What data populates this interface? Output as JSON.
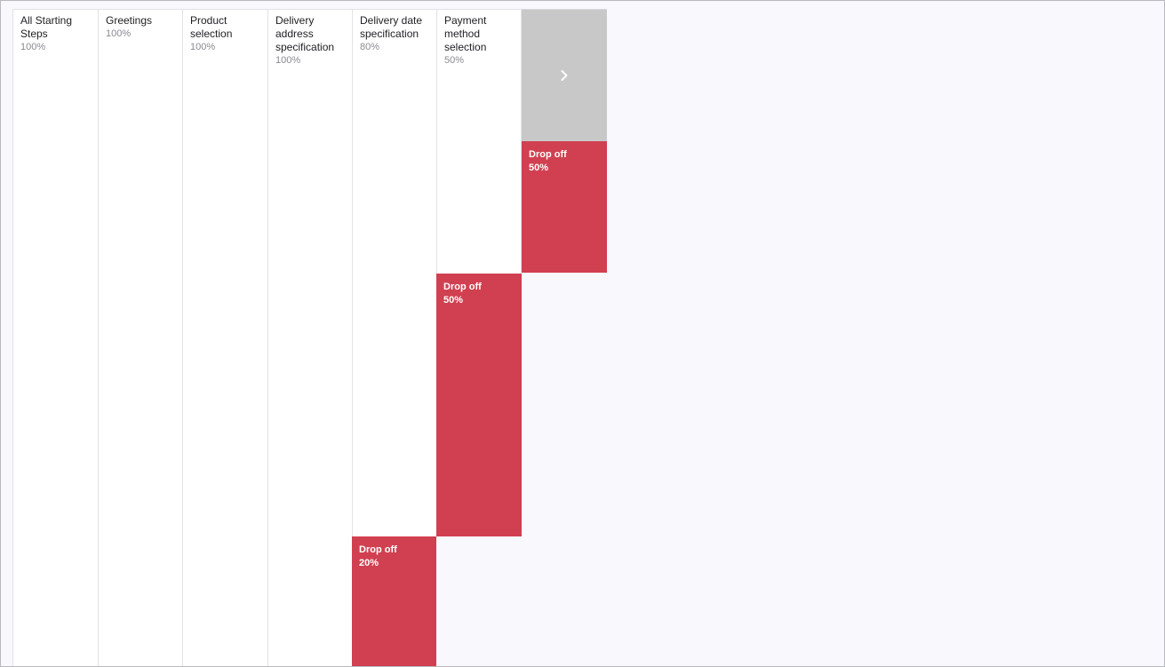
{
  "funnel": {
    "steps": [
      {
        "name": "All Starting Steps",
        "percent": "100%"
      },
      {
        "name": "Greetings",
        "percent": "100%"
      },
      {
        "name": "Product selection",
        "percent": "100%"
      },
      {
        "name": "Delivery address specification",
        "percent": "100%"
      },
      {
        "name": "Delivery date specification",
        "percent": "80%"
      },
      {
        "name": "Payment method selection",
        "percent": "50%"
      }
    ],
    "dropoffs": [
      {
        "label": "Drop off",
        "percent": "20%"
      },
      {
        "label": "Drop off",
        "percent": "50%"
      },
      {
        "label": "Drop off",
        "percent": "50%"
      }
    ],
    "next_icon": "chevron-right-icon"
  },
  "colors": {
    "column_bg": "#ffffff",
    "page_bg": "#f8f8fd",
    "dropoff": "#d14050",
    "next_tile": "#c8c8c8"
  }
}
